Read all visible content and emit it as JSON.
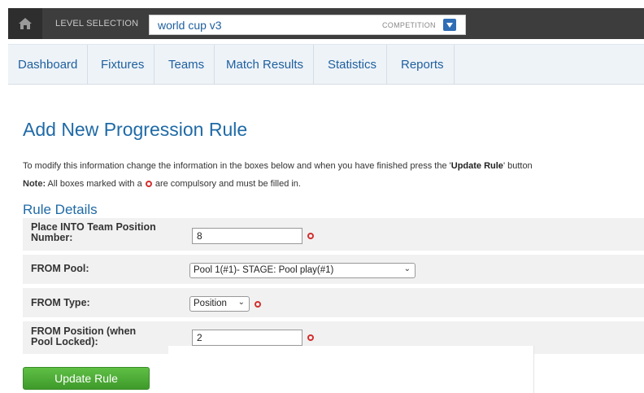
{
  "topbar": {
    "level_label": "LEVEL SELECTION",
    "search_value": "world cup v3",
    "competition_label": "COMPETITION"
  },
  "nav": {
    "tabs": [
      {
        "label": "Dashboard"
      },
      {
        "label": "Fixtures"
      },
      {
        "label": "Teams"
      },
      {
        "label": "Match Results"
      },
      {
        "label": "Statistics"
      },
      {
        "label": "Reports"
      }
    ]
  },
  "main": {
    "title": "Add New Progression Rule",
    "intro_prefix": "To modify this information change the information in the boxes below and when you have finished press the '",
    "intro_bold": "Update Rule",
    "intro_suffix": "' button",
    "note_bold": "Note:",
    "note_prefix": " All boxes marked with a ",
    "note_suffix": " are compulsory and must be filled in.",
    "section_title": "Rule Details",
    "fields": {
      "place_into": {
        "label_line1": "Place INTO Team Position",
        "label_line2": "Number:",
        "value": "8"
      },
      "from_pool": {
        "label": "FROM Pool:",
        "selected": "Pool 1(#1)- STAGE: Pool play(#1)"
      },
      "from_type": {
        "label": "FROM Type:",
        "selected": "Position"
      },
      "from_position": {
        "label_line1": "FROM Position (when",
        "label_line2": "Pool Locked):",
        "value": "2"
      }
    },
    "update_button": "Update Rule"
  },
  "colors": {
    "topbar_bg": "#3d3d3d",
    "nav_bg": "#eef3f8",
    "link_blue": "#1e5f9e",
    "title_blue": "#1f6aa6",
    "required_red": "#d32f2f",
    "button_green": "#4caf35"
  }
}
